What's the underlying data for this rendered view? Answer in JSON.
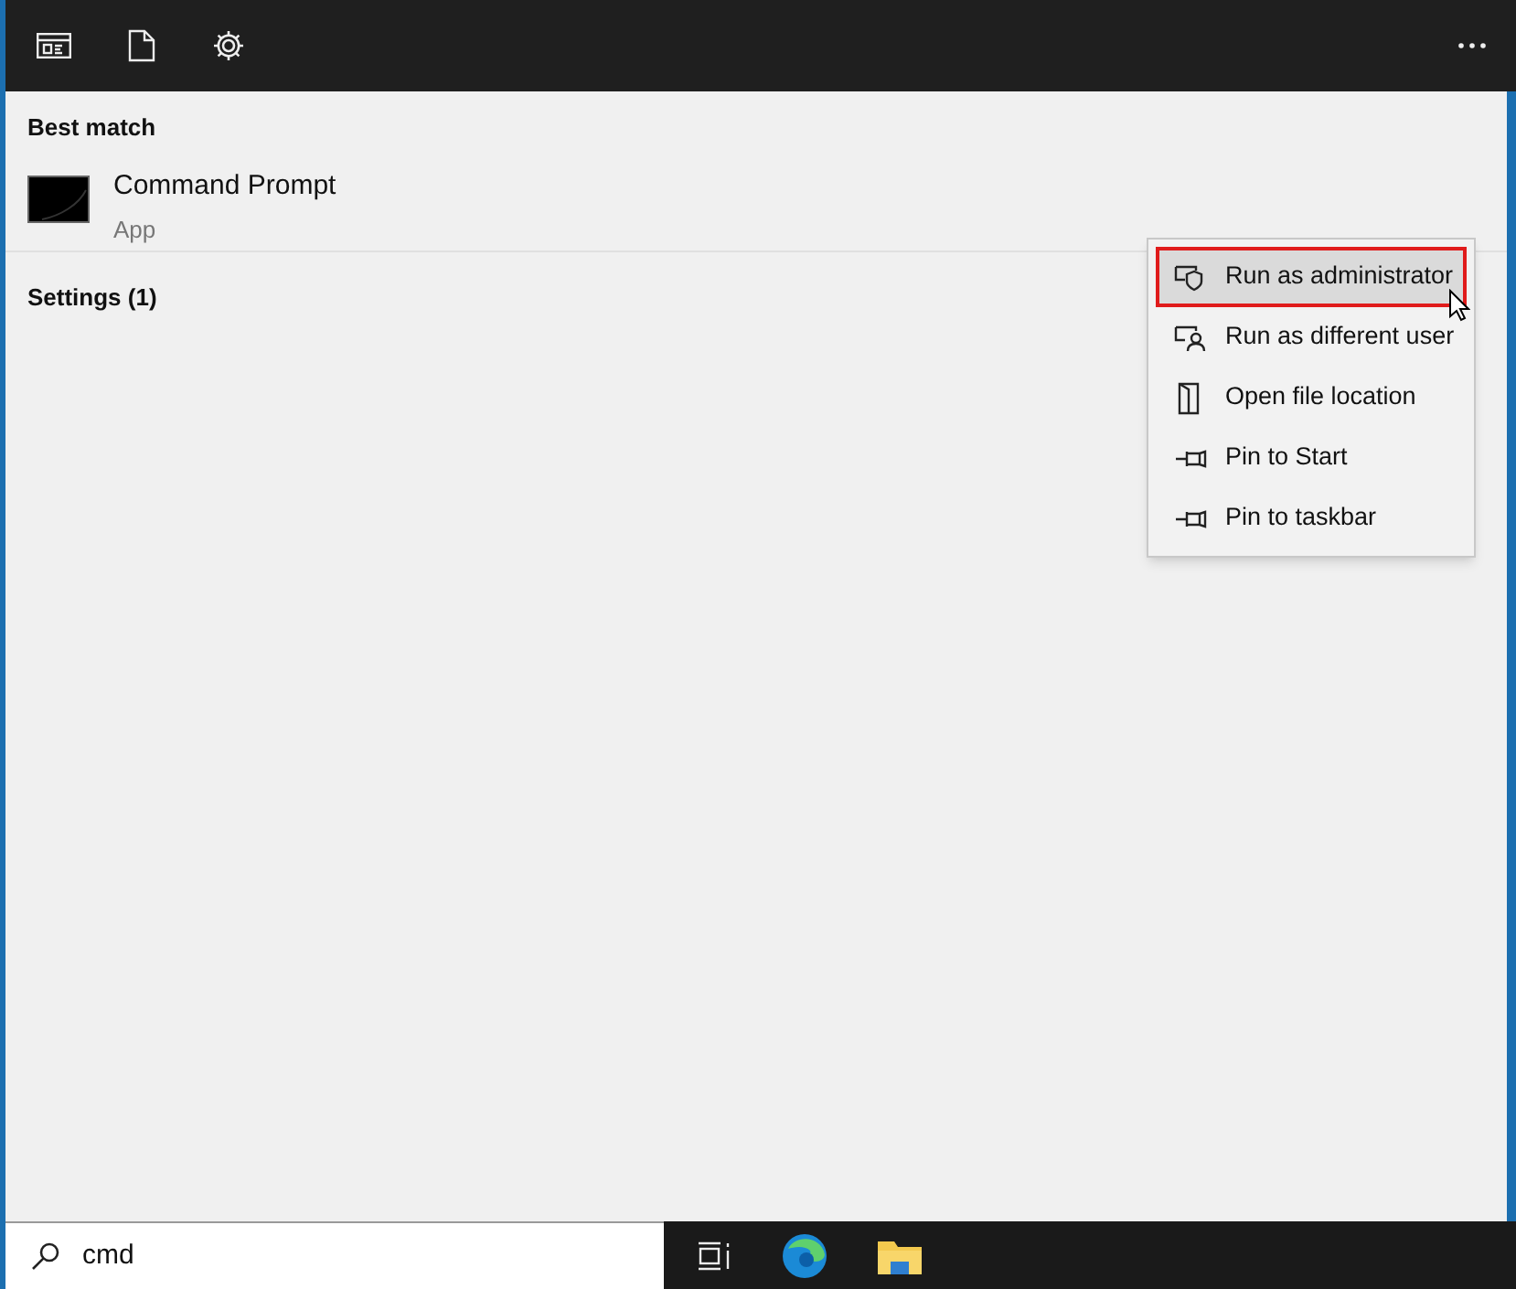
{
  "best_match": {
    "heading": "Best match",
    "result": {
      "title": "Command Prompt",
      "subtitle": "App"
    }
  },
  "settings_group": {
    "heading": "Settings (1)"
  },
  "context_menu": [
    {
      "kind": "admin",
      "label": "Run as administrator",
      "selected": true
    },
    {
      "kind": "user",
      "label": "Run as different user",
      "selected": false
    },
    {
      "kind": "folder",
      "label": "Open file location",
      "selected": false
    },
    {
      "kind": "pin",
      "label": "Pin to Start",
      "selected": false
    },
    {
      "kind": "pin",
      "label": "Pin to taskbar",
      "selected": false
    }
  ],
  "search": {
    "value": "cmd"
  }
}
